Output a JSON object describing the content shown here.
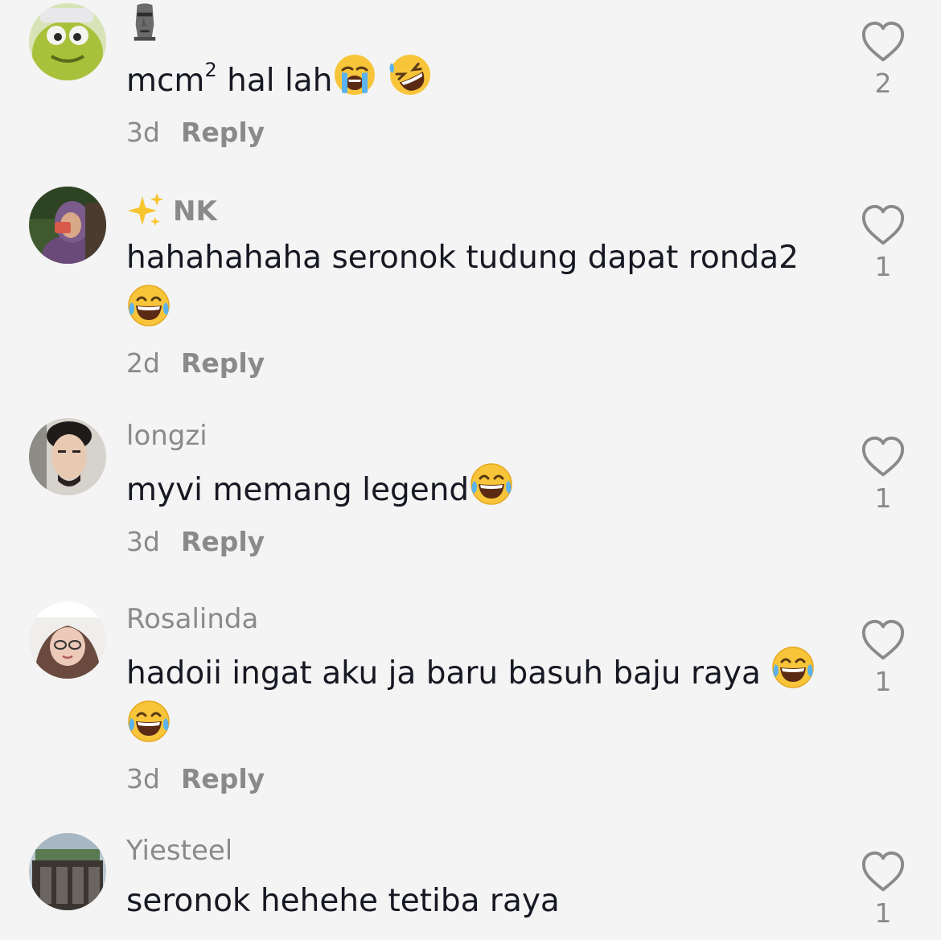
{
  "comments": [
    {
      "username": "",
      "username_icon": "moai-emoji",
      "text_before": "mcm",
      "superscript": "2",
      "text_after": " hal lah",
      "emojis": [
        "crying-face-emoji",
        "rolling-laughing-emoji"
      ],
      "time": "3d",
      "reply_label": "Reply",
      "likes": "2"
    },
    {
      "username": "NK",
      "username_icon": "sparkles-emoji",
      "text": "hahahahaha seronok tudung dapat ronda2",
      "emojis": [
        "tears-of-joy-emoji"
      ],
      "time": "2d",
      "reply_label": "Reply",
      "likes": "1"
    },
    {
      "username": "longzi",
      "text": "myvi memang legend",
      "emojis": [
        "tears-of-joy-emoji"
      ],
      "time": "3d",
      "reply_label": "Reply",
      "likes": "1"
    },
    {
      "username": "Rosalinda",
      "text": "hadoii ingat aku ja baru basuh baju raya ",
      "emojis": [
        "tears-of-joy-emoji",
        "tears-of-joy-emoji"
      ],
      "time": "3d",
      "reply_label": "Reply",
      "likes": "1"
    },
    {
      "username": "Yiesteel",
      "text": "seronok hehehe tetiba raya",
      "likes": "1"
    }
  ],
  "colors": {
    "background": "#f4f4f4",
    "text": "#161823",
    "muted": "#8a8a8a"
  }
}
